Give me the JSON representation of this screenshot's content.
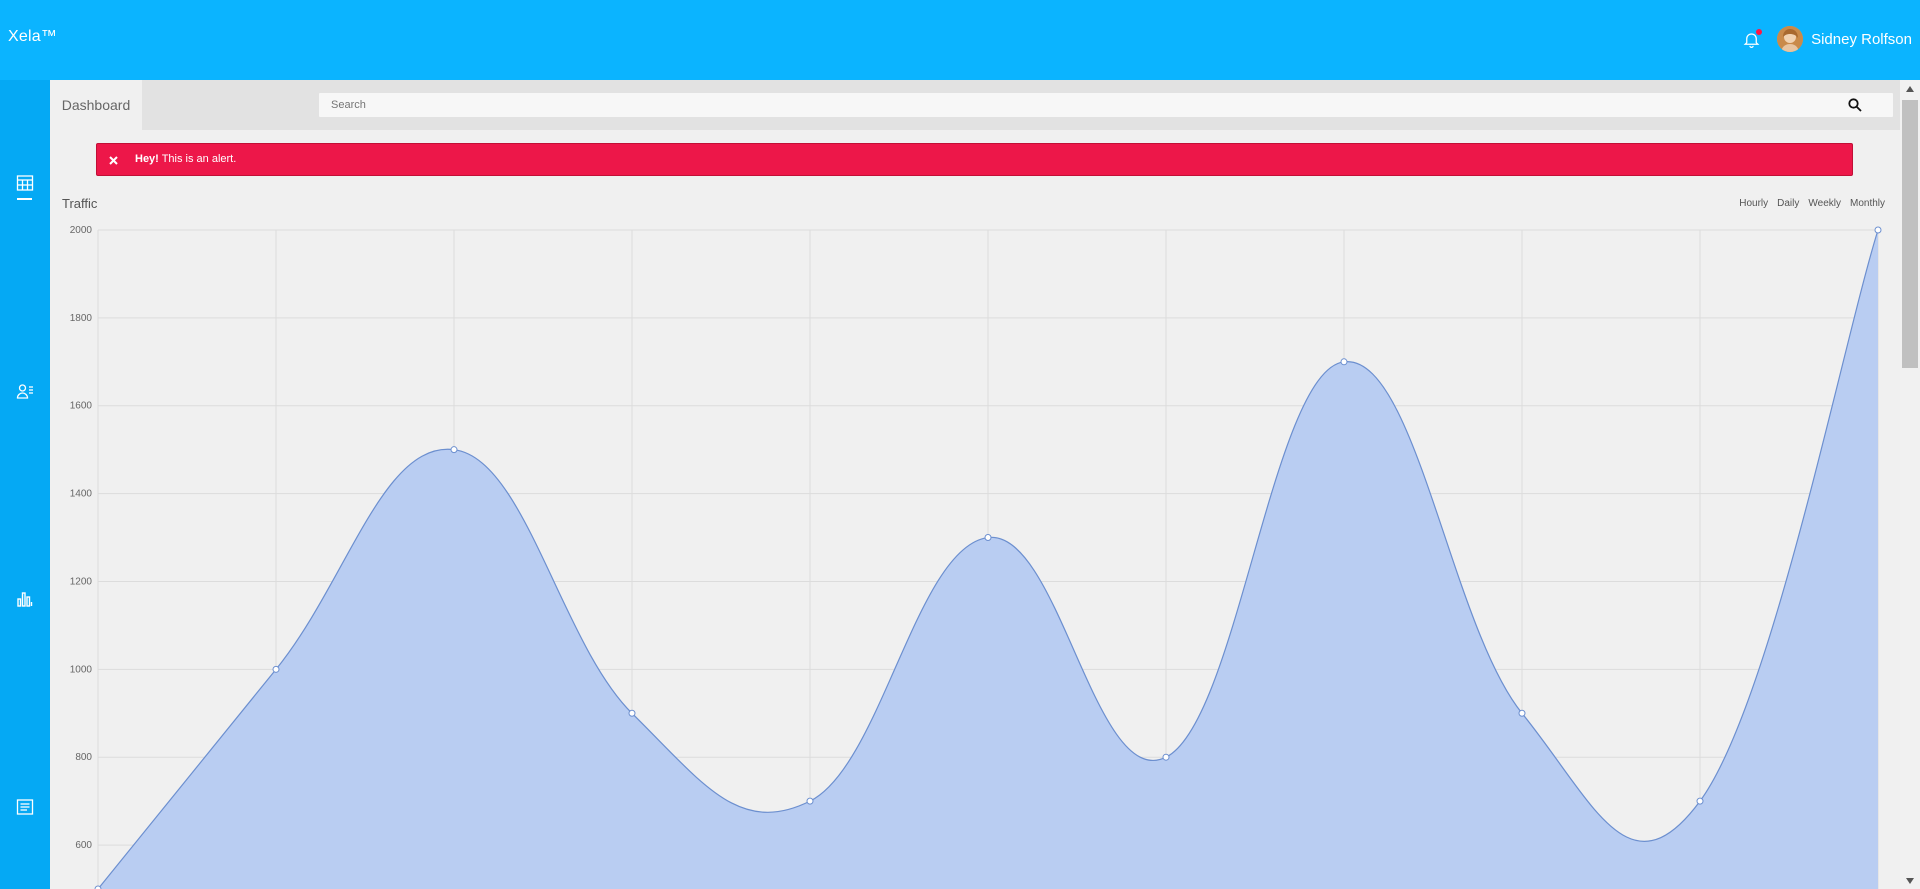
{
  "app": {
    "brand": "Xela™"
  },
  "header": {
    "user_name": "Sidney Rolfson"
  },
  "tabs": {
    "dashboard": "Dashboard"
  },
  "search": {
    "placeholder": "Search"
  },
  "alert": {
    "strong": "Hey!",
    "message": " This is an alert."
  },
  "ranges": [
    "Hourly",
    "Daily",
    "Weekly",
    "Monthly"
  ],
  "colors": {
    "topbar": "#0bb4ff",
    "sidebar": "#05a9f4",
    "alert": "#ed1749",
    "area_fill": "#b9cdf2",
    "area_line": "#6c8fcf"
  },
  "icons": {
    "notifications": "bell-icon",
    "nav": [
      "calendar-icon",
      "contacts-icon",
      "bar-chart-icon",
      "list-icon"
    ],
    "search": "search-icon",
    "close": "close-icon"
  },
  "chart_data": {
    "type": "area",
    "title": "Traffic",
    "x": [
      0,
      1,
      2,
      3,
      4,
      5,
      6,
      7,
      8,
      9,
      10
    ],
    "values": [
      500,
      1000,
      1500,
      900,
      700,
      1300,
      800,
      1700,
      900,
      700,
      2000
    ],
    "yticks": [
      600,
      800,
      1000,
      1200,
      1400,
      1600,
      1800,
      2000
    ],
    "ylim": [
      500,
      2000
    ],
    "grid": true,
    "xlabel": "",
    "ylabel": ""
  }
}
